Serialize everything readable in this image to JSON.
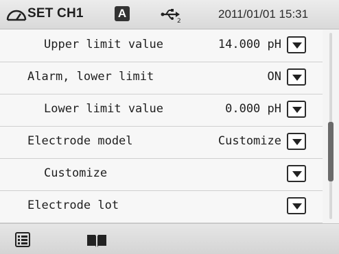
{
  "header": {
    "title": "SET CH1",
    "badge": "A",
    "datetime": "2011/01/01 15:31",
    "icons": [
      "gauge-icon",
      "usb-icon"
    ]
  },
  "rows": [
    {
      "label": "Upper limit value",
      "value": "14.000 pH",
      "indent": true
    },
    {
      "label": "Alarm, lower limit",
      "value": "ON",
      "indent": false
    },
    {
      "label": "Lower limit value",
      "value": "0.000 pH",
      "indent": true
    },
    {
      "label": "Electrode model",
      "value": "Customize",
      "indent": false
    },
    {
      "label": "Customize",
      "value": "",
      "indent": true
    },
    {
      "label": "Electrode lot",
      "value": "",
      "indent": false
    }
  ],
  "scroll": {
    "position": 0.7,
    "visible_fraction": 0.32
  },
  "footer": {
    "icons": [
      "menu-icon",
      "book-icon"
    ]
  },
  "colors": {
    "text": "#1e1e1e",
    "header_bg": "#dcdcdc",
    "thumb": "#6a6a6a"
  }
}
